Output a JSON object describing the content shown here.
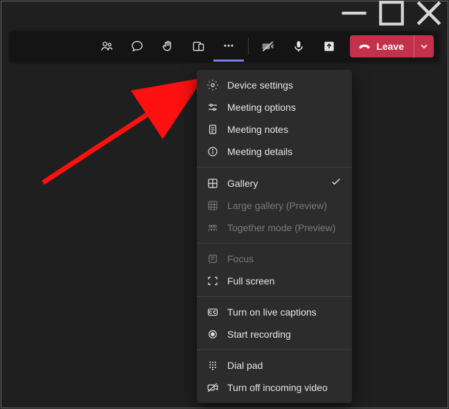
{
  "titlebar": {
    "minimize": "minimize",
    "maximize": "maximize",
    "close": "close"
  },
  "toolbar": {
    "people": "participants",
    "chat": "chat",
    "reactions": "reactions",
    "rooms": "rooms",
    "more": "more-actions",
    "camera": "camera-off",
    "mic": "microphone",
    "share": "share-screen",
    "leave_label": "Leave"
  },
  "menu": {
    "groups": [
      [
        {
          "icon": "gear-icon",
          "label": "Device settings",
          "enabled": true
        },
        {
          "icon": "sliders-icon",
          "label": "Meeting options",
          "enabled": true
        },
        {
          "icon": "notes-icon",
          "label": "Meeting notes",
          "enabled": true
        },
        {
          "icon": "info-icon",
          "label": "Meeting details",
          "enabled": true
        }
      ],
      [
        {
          "icon": "gallery-icon",
          "label": "Gallery",
          "enabled": true,
          "checked": true
        },
        {
          "icon": "large-gallery-icon",
          "label": "Large gallery (Preview)",
          "enabled": false
        },
        {
          "icon": "together-icon",
          "label": "Together mode (Preview)",
          "enabled": false
        }
      ],
      [
        {
          "icon": "focus-icon",
          "label": "Focus",
          "enabled": false
        },
        {
          "icon": "fullscreen-icon",
          "label": "Full screen",
          "enabled": true
        }
      ],
      [
        {
          "icon": "cc-icon",
          "label": "Turn on live captions",
          "enabled": true
        },
        {
          "icon": "record-icon",
          "label": "Start recording",
          "enabled": true
        }
      ],
      [
        {
          "icon": "dialpad-icon",
          "label": "Dial pad",
          "enabled": true
        },
        {
          "icon": "video-off-icon",
          "label": "Turn off incoming video",
          "enabled": true
        }
      ]
    ]
  }
}
